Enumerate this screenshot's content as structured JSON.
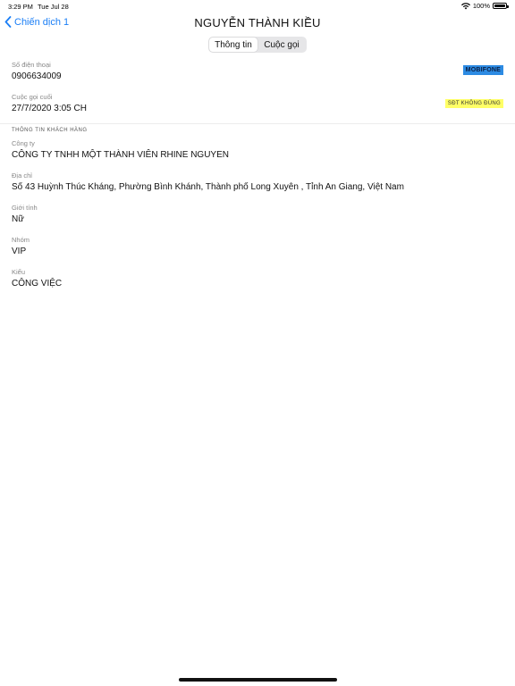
{
  "status": {
    "time": "3:29 PM",
    "date": "Tue Jul 28",
    "battery": "100%"
  },
  "nav": {
    "back_label": "Chiến dịch 1",
    "title": "NGUYỄN THÀNH KIỀU"
  },
  "tabs": [
    {
      "label": "Thông tin",
      "active": true
    },
    {
      "label": "Cuộc gọi",
      "active": false
    }
  ],
  "contact": {
    "phone_label": "Số điện thoại",
    "phone_value": "0906634009",
    "carrier_badge": "MOBIFONE",
    "last_call_label": "Cuộc gọi cuối",
    "last_call_value": "27/7/2020 3:05 CH",
    "warning_badge": "SĐT KHÔNG ĐÚNG"
  },
  "customer": {
    "section_title": "THÔNG TIN KHÁCH HÀNG",
    "company_label": "Công ty",
    "company_value": "CÔNG TY TNHH MỘT THÀNH VIÊN RHINE NGUYEN",
    "address_label": "Địa chỉ",
    "address_value": "Số 43 Huỳnh Thúc Kháng, Phường Bình Khánh, Thành phố Long Xuyên , Tỉnh An Giang, Việt Nam",
    "gender_label": "Giới tính",
    "gender_value": "Nữ",
    "group_label": "Nhóm",
    "group_value": "VIP",
    "type_label": "Kiểu",
    "type_value": "CÔNG VIỆC"
  },
  "colors": {
    "accent": "#1a7ef6",
    "carrier_badge_bg": "#2d8be3",
    "warning_badge_bg": "#ffff66"
  }
}
